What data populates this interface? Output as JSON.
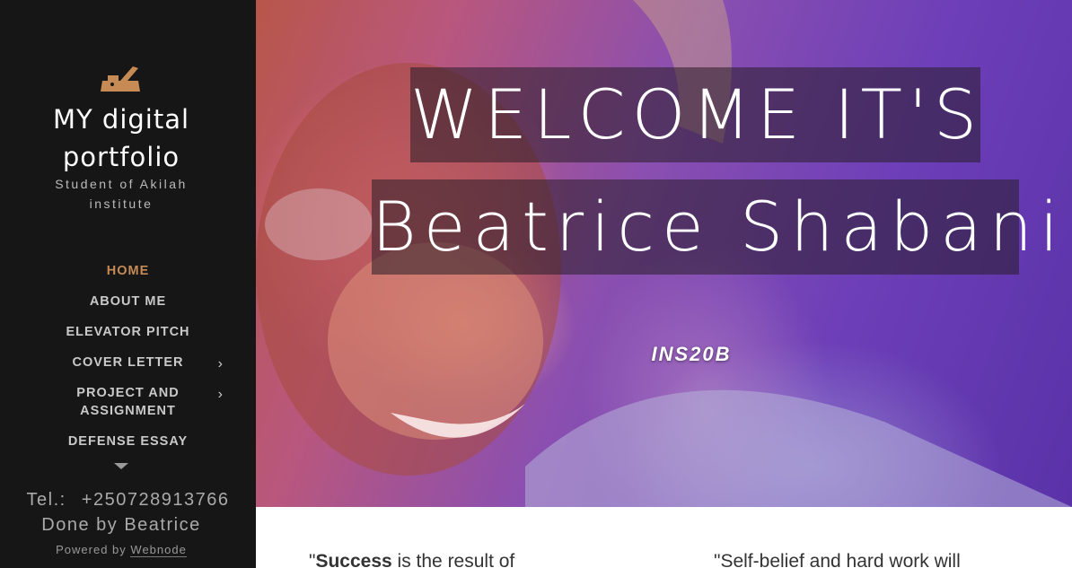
{
  "sidebar": {
    "logo_icon": "plane-tool-icon",
    "title": "MY digital portfolio",
    "subtitle": "Student of Akilah institute",
    "nav": [
      {
        "label": "HOME",
        "active": true,
        "has_submenu": false
      },
      {
        "label": "ABOUT ME",
        "active": false,
        "has_submenu": false
      },
      {
        "label": "ELEVATOR PITCH",
        "active": false,
        "has_submenu": false
      },
      {
        "label": "COVER LETTER",
        "active": false,
        "has_submenu": true
      },
      {
        "label": "PROJECT AND ASSIGNMENT",
        "active": false,
        "has_submenu": true
      },
      {
        "label": "DEFENSE ESSAY",
        "active": false,
        "has_submenu": false
      }
    ],
    "footer": {
      "tel": "Tel.: +250728913766",
      "done_by": "Done by Beatrice",
      "powered_prefix": "Powered by",
      "powered_link": "Webnode"
    }
  },
  "hero": {
    "line1": "WELCOME IT'S",
    "line2": "Beatrice Shabani",
    "tag": "INS20B"
  },
  "content": {
    "quote1_open": "\"",
    "quote1_bold": "Success",
    "quote1_rest": " is the result of",
    "quote2": "\"Self-belief and hard work will"
  },
  "colors": {
    "sidebar_bg": "#161616",
    "accent": "#c68a55"
  }
}
